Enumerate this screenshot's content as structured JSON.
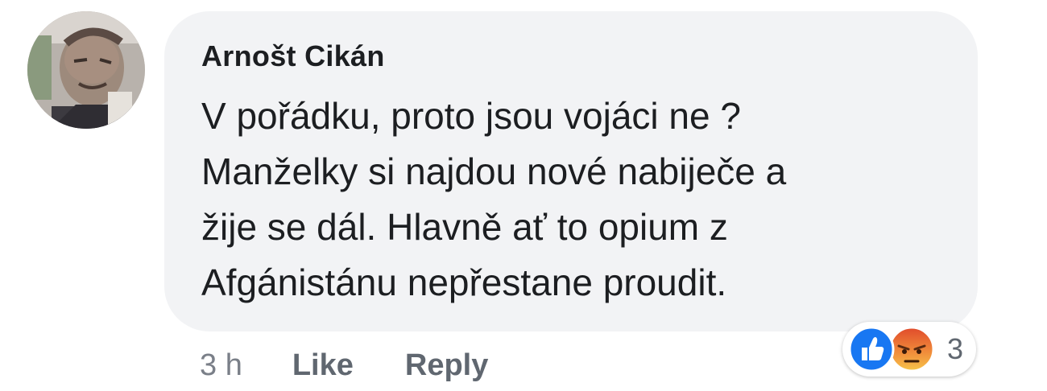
{
  "comment": {
    "author": "Arnošt Cikán",
    "text_lines": [
      "V pořádku, proto jsou vojáci ne ?",
      "Manželky si najdou nové nabiječe a",
      "žije se dál. Hlavně ať to opium z",
      "Afgánistánu nepřestane proudit."
    ],
    "time": "3 h",
    "like_label": "Like",
    "reply_label": "Reply",
    "reactions": {
      "icons": [
        "like-icon",
        "angry-icon"
      ],
      "count": "3"
    }
  },
  "colors": {
    "bubble_bg": "#f2f3f5",
    "like_blue": "#1877f2",
    "angry_orange": "#e9710f",
    "meta_gray": "#606770"
  }
}
